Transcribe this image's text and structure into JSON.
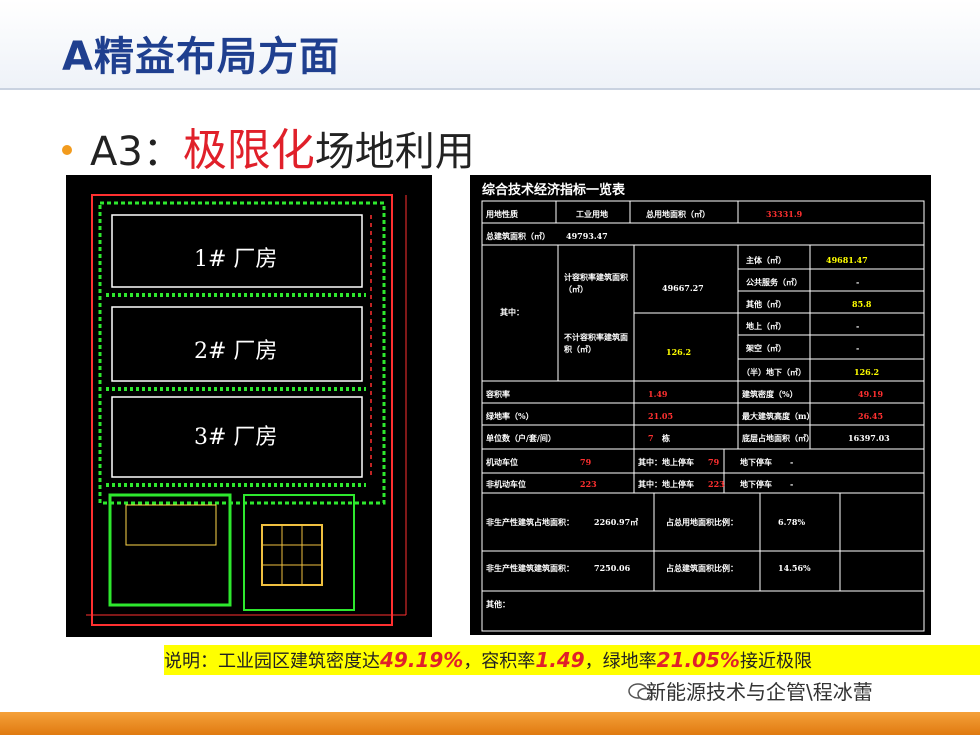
{
  "slide": {
    "title": "A精益布局方面",
    "subtitle_prefix": "A3：",
    "subtitle_emphasis": "极限化",
    "subtitle_suffix": "场地利用"
  },
  "site_plan": {
    "buildings": [
      "1#  厂房",
      "2#  厂房",
      "3#  厂房"
    ]
  },
  "table": {
    "title": "综合技术经济指标一览表",
    "cells": {
      "land_nature_label": "用地性质",
      "land_nature_value": "工业用地",
      "total_land_label": "总用地面积（㎡）",
      "total_land_value": "33331.9",
      "total_build_label": "总建筑面积（㎡）",
      "total_build_value": "49793.47",
      "among": "其中：",
      "far_area_label": "计容积率建筑面积（㎡）",
      "far_area_value": "49667.27",
      "main_label": "主体（㎡）",
      "main_value": "49681.47",
      "public_label": "公共服务（㎡）",
      "public_value": "-",
      "other_label": "其他（㎡）",
      "other_value": "85.8",
      "nonfar_label": "不计容积率建筑面积（㎡）",
      "nonfar_value": "126.2",
      "above_label": "地上（㎡）",
      "above_value": "-",
      "overhead_label": "架空（㎡）",
      "overhead_value": "-",
      "under_label": "（半）地下（㎡）",
      "under_value": "126.2",
      "far_label": "容积率",
      "far_value": "1.49",
      "density_label": "建筑密度（%）",
      "density_value": "49.19",
      "green_label": "绿地率（%）",
      "green_value": "21.05",
      "height_label": "最大建筑高度（m）",
      "height_value": "26.45",
      "units_label": "单位数（户/套/间）",
      "units_value": "7",
      "units_unit": "栋",
      "footprint_label": "底层占地面积（㎡）",
      "footprint_value": "16397.03",
      "car_label": "机动车位",
      "car_value": "79",
      "car_above_label": "其中：地上停车",
      "car_above_value": "79",
      "car_under_label": "地下停车",
      "car_under_value": "-",
      "bike_label": "非机动车位",
      "bike_value": "223",
      "bike_above_label": "其中：地上停车",
      "bike_above_value": "223",
      "bike_under_label": "地下停车",
      "bike_under_value": "-",
      "support_land_label": "非生产性建筑占地面积：",
      "support_land_value": "2260.97㎡",
      "support_land_ratio_label": "占总用地面积比例：",
      "support_land_ratio_value": "6.78%",
      "support_build_label": "非生产性建筑建筑面积：",
      "support_build_value": "7250.06",
      "support_build_ratio_label": "占总建筑面积比例：",
      "support_build_ratio_value": "14.56%",
      "other_note_label": "其他："
    }
  },
  "note": {
    "p1": "说明：工业园区建筑密度达",
    "v1": "49.19%",
    "p2": "，容积率",
    "v2": "1.49",
    "p3": "，绿地率",
    "v3": "21.05%",
    "p4": "接近极限"
  },
  "watermark": "新能源技术与企管\\程冰蕾",
  "colors": {
    "title": "#1f3f8f",
    "emphasis": "#e0202a",
    "bullet": "#f29b1d",
    "note_bg": "#ffff00",
    "footer": "#e88a20"
  }
}
